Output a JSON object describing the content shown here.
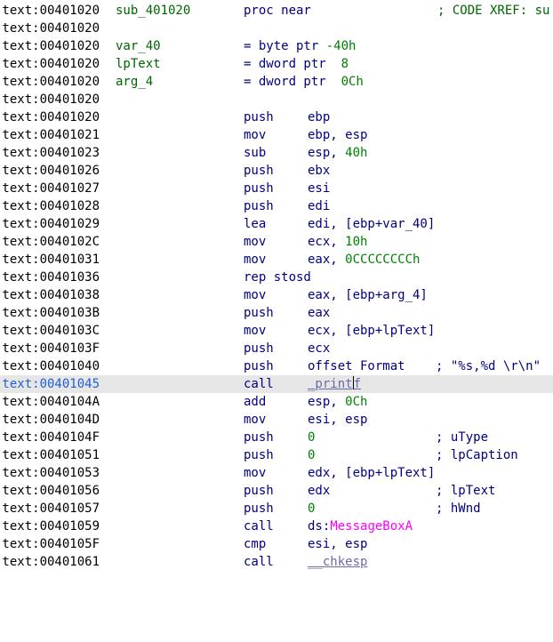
{
  "rows": [
    {
      "addr": ".text:00401020",
      "label": "sub_401020",
      "mnem": "proc near",
      "ops": "",
      "cmt": "; CODE XREF: su"
    },
    {
      "addr": ".text:00401020",
      "label": "",
      "mnem": "",
      "ops": "",
      "cmt": ""
    },
    {
      "addr": ".text:00401020",
      "label": "var_40",
      "mnem": "= byte ptr -40h",
      "ops": "",
      "cmt": ""
    },
    {
      "addr": ".text:00401020",
      "label": "lpText",
      "mnem": "= dword ptr  8",
      "ops": "",
      "cmt": ""
    },
    {
      "addr": ".text:00401020",
      "label": "arg_4",
      "mnem": "= dword ptr  0Ch",
      "ops": "",
      "cmt": ""
    },
    {
      "addr": ".text:00401020",
      "label": "",
      "mnem": "",
      "ops": "",
      "cmt": ""
    },
    {
      "addr": ".text:00401020",
      "label": "",
      "mnem": "push",
      "ops": "ebp",
      "cmt": ""
    },
    {
      "addr": ".text:00401021",
      "label": "",
      "mnem": "mov",
      "ops": "ebp, esp",
      "cmt": ""
    },
    {
      "addr": ".text:00401023",
      "label": "",
      "mnem": "sub",
      "ops": "esp, 40h",
      "cmt": ""
    },
    {
      "addr": ".text:00401026",
      "label": "",
      "mnem": "push",
      "ops": "ebx",
      "cmt": ""
    },
    {
      "addr": ".text:00401027",
      "label": "",
      "mnem": "push",
      "ops": "esi",
      "cmt": ""
    },
    {
      "addr": ".text:00401028",
      "label": "",
      "mnem": "push",
      "ops": "edi",
      "cmt": ""
    },
    {
      "addr": ".text:00401029",
      "label": "",
      "mnem": "lea",
      "ops": "edi, [ebp+var_40]",
      "cmt": ""
    },
    {
      "addr": ".text:0040102C",
      "label": "",
      "mnem": "mov",
      "ops": "ecx, 10h",
      "cmt": ""
    },
    {
      "addr": ".text:00401031",
      "label": "",
      "mnem": "mov",
      "ops": "eax, 0CCCCCCCCh",
      "cmt": ""
    },
    {
      "addr": ".text:00401036",
      "label": "",
      "mnem": "rep stosd",
      "ops": "",
      "cmt": ""
    },
    {
      "addr": ".text:00401038",
      "label": "",
      "mnem": "mov",
      "ops": "eax, [ebp+arg_4]",
      "cmt": ""
    },
    {
      "addr": ".text:0040103B",
      "label": "",
      "mnem": "push",
      "ops": "eax",
      "cmt": ""
    },
    {
      "addr": ".text:0040103C",
      "label": "",
      "mnem": "mov",
      "ops": "ecx, [ebp+lpText]",
      "cmt": ""
    },
    {
      "addr": ".text:0040103F",
      "label": "",
      "mnem": "push",
      "ops": "ecx",
      "cmt": ""
    },
    {
      "addr": ".text:00401040",
      "label": "",
      "mnem": "push",
      "ops": "offset Format",
      "cmt": "; \"%s,%d \\r\\n\""
    },
    {
      "addr": ".text:00401045",
      "label": "",
      "mnem": "call",
      "ops": "_printf",
      "cmt": ""
    },
    {
      "addr": ".text:0040104A",
      "label": "",
      "mnem": "add",
      "ops": "esp, 0Ch",
      "cmt": ""
    },
    {
      "addr": ".text:0040104D",
      "label": "",
      "mnem": "mov",
      "ops": "esi, esp",
      "cmt": ""
    },
    {
      "addr": ".text:0040104F",
      "label": "",
      "mnem": "push",
      "ops": "0",
      "cmt": "; uType"
    },
    {
      "addr": ".text:00401051",
      "label": "",
      "mnem": "push",
      "ops": "0",
      "cmt": "; lpCaption"
    },
    {
      "addr": ".text:00401053",
      "label": "",
      "mnem": "mov",
      "ops": "edx, [ebp+lpText]",
      "cmt": ""
    },
    {
      "addr": ".text:00401056",
      "label": "",
      "mnem": "push",
      "ops": "edx",
      "cmt": "; lpText"
    },
    {
      "addr": ".text:00401057",
      "label": "",
      "mnem": "push",
      "ops": "0",
      "cmt": "; hWnd"
    },
    {
      "addr": ".text:00401059",
      "label": "",
      "mnem": "call",
      "ops": "ds:MessageBoxA",
      "cmt": ""
    },
    {
      "addr": ".text:0040105F",
      "label": "",
      "mnem": "cmp",
      "ops": "esi, esp",
      "cmt": ""
    },
    {
      "addr": ".text:00401061",
      "label": "",
      "mnem": "call",
      "ops": "__chkesp",
      "cmt": ""
    }
  ],
  "selected_row": 21,
  "colors": {
    "address": "#000000",
    "selected_address": "#1f5fd6",
    "selected_background": "#e6e6e6",
    "label": "#006400",
    "instruction": "#00007f",
    "number": "#008000",
    "import": "#ff00ff",
    "library_function": "#6a6aaa"
  }
}
